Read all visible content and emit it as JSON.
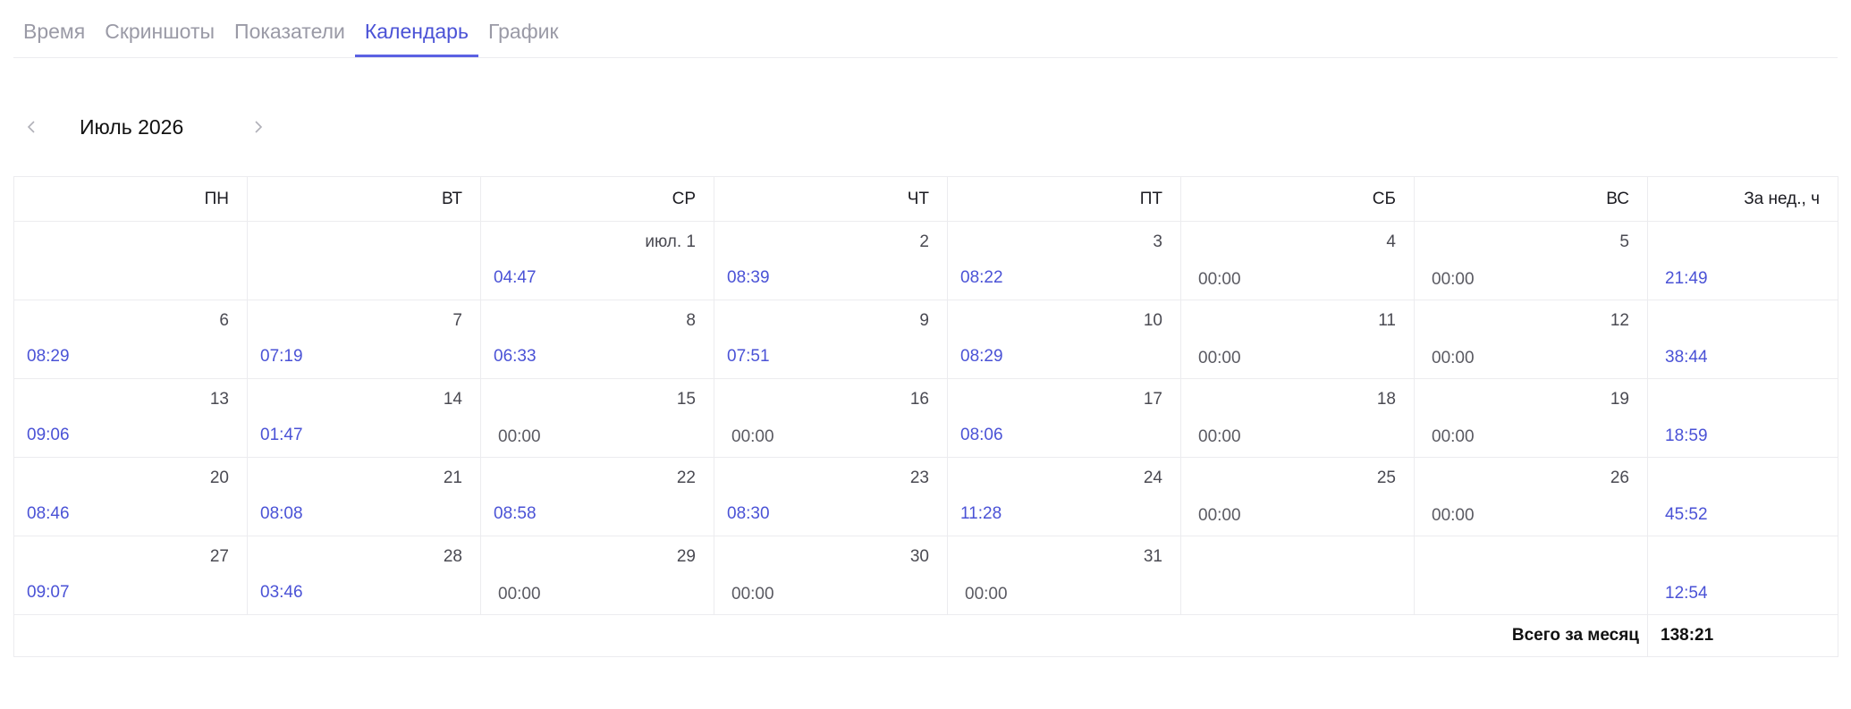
{
  "tabs": [
    {
      "label": "Время"
    },
    {
      "label": "Скриншоты"
    },
    {
      "label": "Показатели"
    },
    {
      "label": "Календарь"
    },
    {
      "label": "График"
    }
  ],
  "active_tab": "Календарь",
  "month_nav": {
    "label": "Июль 2026",
    "prev_icon": "chevron-left-icon",
    "next_icon": "chevron-right-icon"
  },
  "calendar": {
    "headers": [
      "ПН",
      "ВТ",
      "СР",
      "ЧТ",
      "ПТ",
      "СБ",
      "ВС",
      "За нед., ч"
    ],
    "weeks": [
      {
        "days": [
          {
            "num": "",
            "time": ""
          },
          {
            "num": "",
            "time": ""
          },
          {
            "num": "июл. 1",
            "time": "04:47"
          },
          {
            "num": "2",
            "time": "08:39"
          },
          {
            "num": "3",
            "time": "08:22"
          },
          {
            "num": "4",
            "time": "00:00"
          },
          {
            "num": "5",
            "time": "00:00"
          }
        ],
        "total": "21:49"
      },
      {
        "days": [
          {
            "num": "6",
            "time": "08:29"
          },
          {
            "num": "7",
            "time": "07:19"
          },
          {
            "num": "8",
            "time": "06:33"
          },
          {
            "num": "9",
            "time": "07:51"
          },
          {
            "num": "10",
            "time": "08:29"
          },
          {
            "num": "11",
            "time": "00:00"
          },
          {
            "num": "12",
            "time": "00:00"
          }
        ],
        "total": "38:44"
      },
      {
        "days": [
          {
            "num": "13",
            "time": "09:06"
          },
          {
            "num": "14",
            "time": "01:47"
          },
          {
            "num": "15",
            "time": "00:00"
          },
          {
            "num": "16",
            "time": "00:00"
          },
          {
            "num": "17",
            "time": "08:06"
          },
          {
            "num": "18",
            "time": "00:00"
          },
          {
            "num": "19",
            "time": "00:00"
          }
        ],
        "total": "18:59"
      },
      {
        "days": [
          {
            "num": "20",
            "time": "08:46"
          },
          {
            "num": "21",
            "time": "08:08"
          },
          {
            "num": "22",
            "time": "08:58"
          },
          {
            "num": "23",
            "time": "08:30"
          },
          {
            "num": "24",
            "time": "11:28"
          },
          {
            "num": "25",
            "time": "00:00"
          },
          {
            "num": "26",
            "time": "00:00"
          }
        ],
        "total": "45:52"
      },
      {
        "days": [
          {
            "num": "27",
            "time": "09:07"
          },
          {
            "num": "28",
            "time": "03:46"
          },
          {
            "num": "29",
            "time": "00:00"
          },
          {
            "num": "30",
            "time": "00:00"
          },
          {
            "num": "31",
            "time": "00:00"
          },
          {
            "num": "",
            "time": ""
          },
          {
            "num": "",
            "time": ""
          }
        ],
        "total": "12:54"
      }
    ],
    "month_total_label": "Всего за месяц",
    "month_total": "138:21"
  },
  "colors": {
    "accent": "#4a52d6",
    "tab_inactive": "#9a9aa6",
    "border": "#ececef",
    "zero_time": "#5a5a62"
  }
}
